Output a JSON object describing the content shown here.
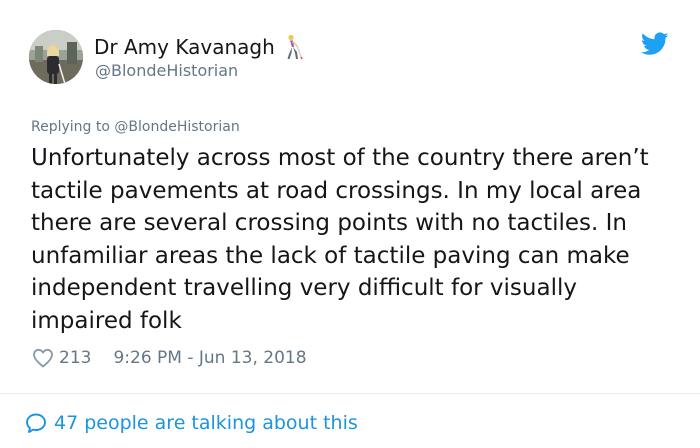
{
  "author": {
    "display_name": "Dr Amy Kavanagh",
    "name_emoji": "person-with-white-cane-icon",
    "handle": "@BlondeHistorian"
  },
  "reply_context": {
    "prefix": "Replying to",
    "mention": "@BlondeHistorian"
  },
  "tweet": {
    "text": "Unfortunately across most of the country there aren’t tactile pavements at road crossings. In my local area there are several crossing points with no tactiles. In unfamiliar areas the lack of tactile paving can make independent travelling very difficult for visually impaired folk",
    "like_count": "213",
    "timestamp": "9:26 PM - Jun 13, 2018"
  },
  "footer": {
    "conversation_label": "47 people are talking about this"
  },
  "colors": {
    "twitter_blue": "#1da1f2",
    "link_blue": "#1b95e0",
    "secondary_text": "#657786",
    "primary_text": "#14171a",
    "divider": "#e6ecf0"
  },
  "icons": {
    "brand": "twitter-bird-icon",
    "like": "heart-outline-icon",
    "conversation": "speech-bubble-icon"
  }
}
